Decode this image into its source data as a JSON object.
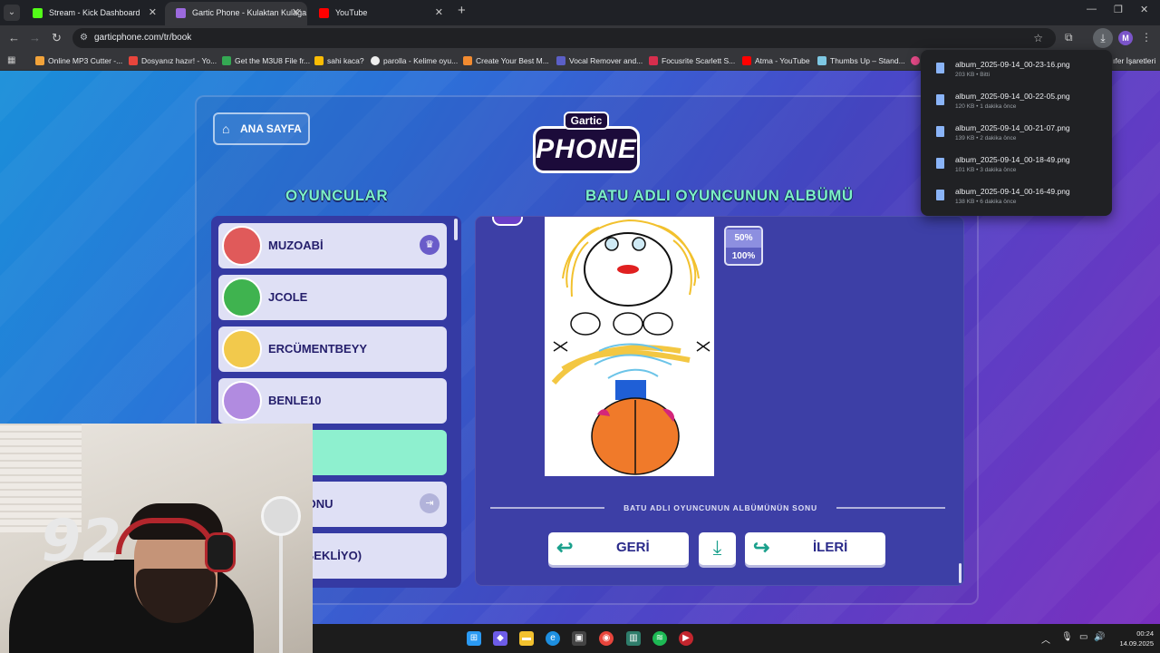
{
  "browser": {
    "tabs": [
      {
        "title": "Stream - Kick Dashboard",
        "active": false,
        "favicon_color": "#53fc18"
      },
      {
        "title": "Gartic Phone - Kulaktan Kulağa",
        "active": true,
        "favicon_color": "#9c6ade"
      },
      {
        "title": "YouTube",
        "active": false,
        "favicon_color": "#ff0000"
      }
    ],
    "url": "garticphone.com/tr/book",
    "bookmarks": [
      {
        "label": "Online MP3 Cutter -...",
        "color": "#f2a33a"
      },
      {
        "label": "Dosyanız hazır! - Yo...",
        "color": "#e8453c"
      },
      {
        "label": "Get the M3U8 File fr...",
        "color": "#34a853"
      },
      {
        "label": "sahi kaca?",
        "color": "#fbbc04"
      },
      {
        "label": "parolla - Kelime oyu...",
        "color": "#eeeeee"
      },
      {
        "label": "Create Your Best M...",
        "color": "#f28b30"
      },
      {
        "label": "Vocal Remover and...",
        "color": "#5b5fc7"
      },
      {
        "label": "Focusrite Scarlett S...",
        "color": "#d62e4d"
      },
      {
        "label": "Atma - YouTube",
        "color": "#ff0000"
      },
      {
        "label": "Thumbs Up – Stand...",
        "color": "#7ec8e3"
      }
    ],
    "bookmarks_overflow": "ıfer İşaretleri",
    "profile_initial": "M"
  },
  "downloads": [
    {
      "name": "album_2025-09-14_00-23-16.png",
      "meta": "203 KB • Bitti"
    },
    {
      "name": "album_2025-09-14_00-22-05.png",
      "meta": "120 KB • 1 dakika önce"
    },
    {
      "name": "album_2025-09-14_00-21-07.png",
      "meta": "139 KB • 2 dakika önce"
    },
    {
      "name": "album_2025-09-14_00-18-49.png",
      "meta": "101 KB • 3 dakika önce"
    },
    {
      "name": "album_2025-09-14_00-16-49.png",
      "meta": "138 KB • 6 dakika önce"
    }
  ],
  "game": {
    "home_button": "ANA SAYFA",
    "logo_top": "Gartic",
    "logo_bottom": "PHONE",
    "players_title": "OYUNCULAR",
    "album_title": "BATU ADLI OYUNCUNUN ALBÜMÜ",
    "players": [
      {
        "name": "MUZOABİ",
        "host": true,
        "avatar_color": "#e05a5a"
      },
      {
        "name": "JCOLE",
        "host": false,
        "avatar_color": "#3fb34f"
      },
      {
        "name": "ERCÜMENTBEYY",
        "host": false,
        "avatar_color": "#f2c94c"
      },
      {
        "name": "BENLE10",
        "host": false,
        "avatar_color": "#b18be0"
      },
      {
        "name": "",
        "host": false,
        "avatar_color": "#8ef0cf"
      },
      {
        "name": "TE BİDONU",
        "host": false,
        "avatar_color": "#dfe0f5"
      },
      {
        "name": "(TALİPBEKLİYO)",
        "host": false,
        "avatar_color": "#dfe0f5"
      }
    ],
    "zoom": {
      "options": [
        "50%",
        "100%"
      ],
      "selected": "50%"
    },
    "album_end_text": "BATU ADLI OYUNCUNUN ALBÜMÜNÜN SONU",
    "back_button": "GERİ",
    "next_button": "İLERİ"
  },
  "taskbar": {
    "time": "00:24",
    "date": "14.09.2025"
  },
  "webcam": {
    "jersey_number": "92"
  }
}
